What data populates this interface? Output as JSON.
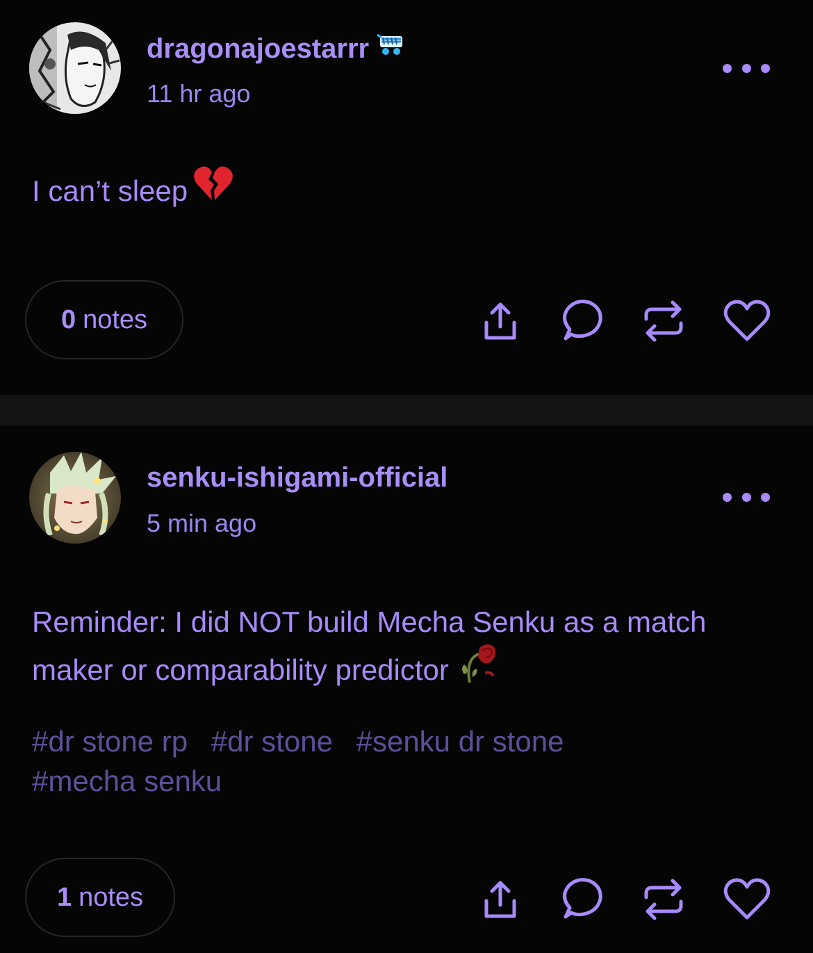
{
  "posts": [
    {
      "username": "dragonajoestarrr",
      "timestamp": "11 hr ago",
      "body": "I can’t sleep",
      "body_emoji": "broken-heart-emoji",
      "tags": [],
      "notes_count": "0",
      "notes_label": "notes"
    },
    {
      "username": "senku-ishigami-official",
      "timestamp": "5 min ago",
      "body": "Reminder: I did NOT build Mecha Senku as a match maker or comparability predictor",
      "body_emoji": "wilted-rose-emoji",
      "tags": [
        "#dr stone rp",
        "#dr stone",
        "#senku dr stone",
        "#mecha senku"
      ],
      "notes_count": "1",
      "notes_label": "notes"
    }
  ],
  "colors": {
    "accent": "#a78bfa",
    "tag": "#5e4f98",
    "background": "#050506",
    "divider": "#141416",
    "pill_border": "#26262a"
  },
  "icons": [
    "more-icon",
    "share-icon",
    "reply-icon",
    "reblog-icon",
    "like-icon"
  ]
}
